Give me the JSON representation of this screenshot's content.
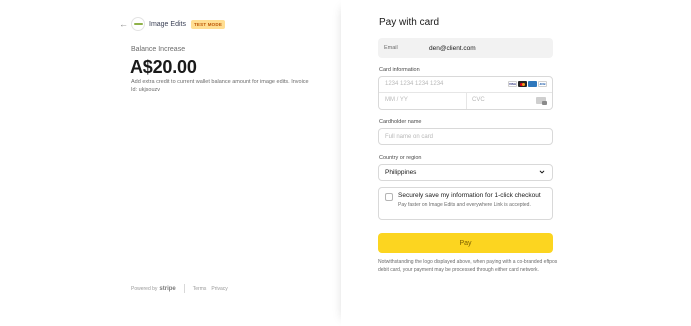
{
  "merchant": {
    "name": "Image Edits",
    "badge": "TEST MODE"
  },
  "product": {
    "name": "Balance Increase",
    "amount": "A$20.00",
    "description": "Add extra credit to current wallet balance amount for image edits. Invoice Id: ukjsouzv"
  },
  "footer": {
    "powered_by": "Powered by",
    "stripe": "stripe",
    "terms": "Terms",
    "privacy": "Privacy"
  },
  "payment": {
    "title": "Pay with card",
    "email_label": "Email",
    "email_value": "den@client.com",
    "card_label": "Card information",
    "card_number_placeholder": "1234 1234 1234 1234",
    "expiry_placeholder": "MM / YY",
    "cvc_placeholder": "CVC",
    "card_brands": [
      "VISA",
      "mastercard",
      "amex",
      "JCB"
    ],
    "cardholder_label": "Cardholder name",
    "cardholder_placeholder": "Full name on card",
    "country_label": "Country or region",
    "country_value": "Philippines",
    "save_title": "Securely save my information for 1-click checkout",
    "save_subtitle": "Pay faster on Image Edits and everywhere Link is accepted.",
    "pay_button": "Pay",
    "notice": "Notwithstanding the logo displayed above, when paying with a co-branded eftpos debit card, your payment may be processed through either card network."
  },
  "colors": {
    "pay_button": "#fcd520",
    "test_badge_bg": "#ffde92",
    "test_badge_text": "#bb5504"
  }
}
